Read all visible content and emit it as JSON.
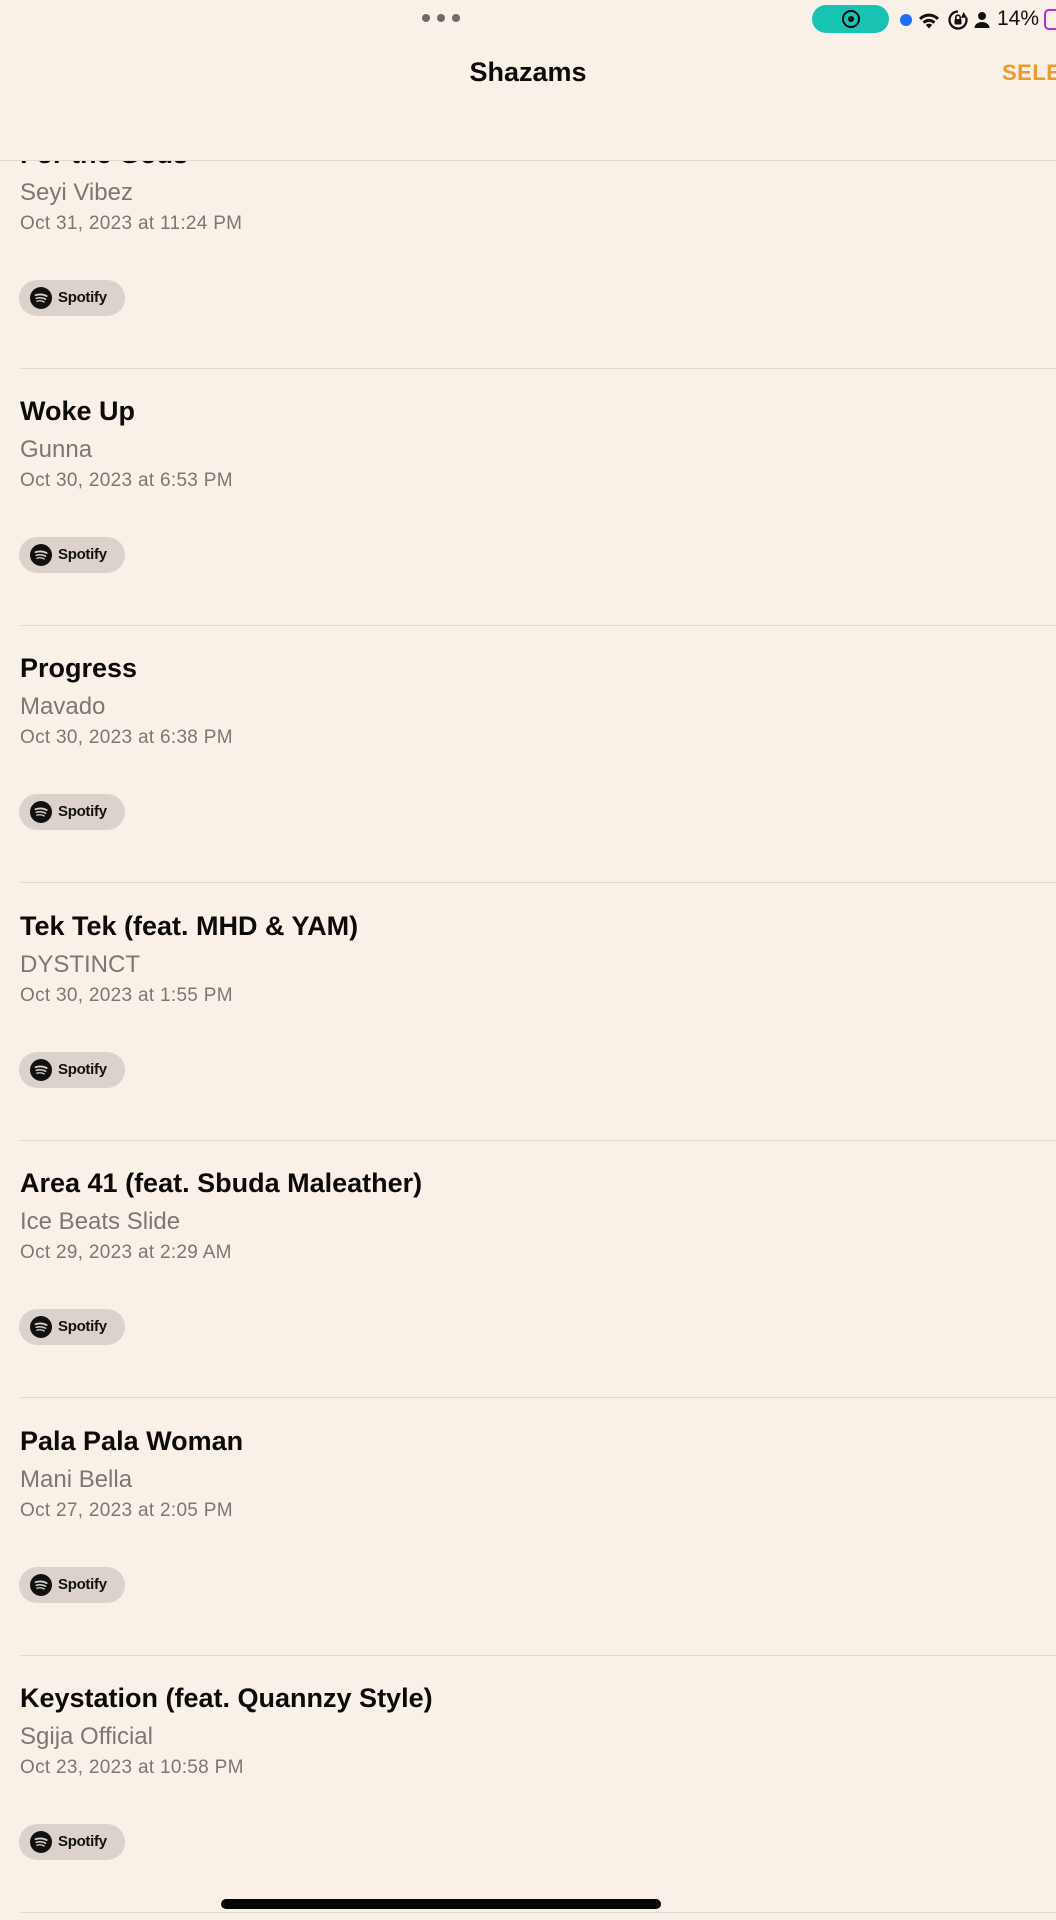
{
  "status_bar": {
    "multitask_icon": "ellipsis-icon",
    "recording_icon": "screen-recording-icon",
    "wifi_icon": "wifi-icon",
    "rotation_lock_icon": "rotation-lock-icon",
    "person_icon": "person-icon",
    "battery_percent": "14%",
    "battery_icon": "battery-icon",
    "colors": {
      "recording": "#18c3b4",
      "location_dot": "#1d6ff2",
      "battery": "#b02fd6"
    }
  },
  "nav": {
    "title": "Shazams",
    "select_label": "SELE",
    "accent_color": "#ea9a2e"
  },
  "partial_item": {
    "title": "For the Gods",
    "artist": "Seyi Vibez",
    "date": "Oct 31, 2023 at 11:24 PM",
    "spotify_label": "Spotify"
  },
  "items": [
    {
      "title": "Woke Up",
      "artist": "Gunna",
      "date": "Oct 30, 2023 at 6:53 PM",
      "spotify_label": "Spotify"
    },
    {
      "title": "Progress",
      "artist": "Mavado",
      "date": "Oct 30, 2023 at 6:38 PM",
      "spotify_label": "Spotify"
    },
    {
      "title": "Tek Tek (feat. MHD & YAM)",
      "artist": "DYSTINCT",
      "date": "Oct 30, 2023 at 1:55 PM",
      "spotify_label": "Spotify"
    },
    {
      "title": "Area 41 (feat. Sbuda Maleather)",
      "artist": "Ice Beats Slide",
      "date": "Oct 29, 2023 at 2:29 AM",
      "spotify_label": "Spotify"
    },
    {
      "title": "Pala Pala Woman",
      "artist": "Mani Bella",
      "date": "Oct 27, 2023 at 2:05 PM",
      "spotify_label": "Spotify"
    },
    {
      "title": "Keystation (feat. Quannzy Style)",
      "artist": "Sgija Official",
      "date": "Oct 23, 2023 at 10:58 PM",
      "spotify_label": "Spotify"
    }
  ]
}
